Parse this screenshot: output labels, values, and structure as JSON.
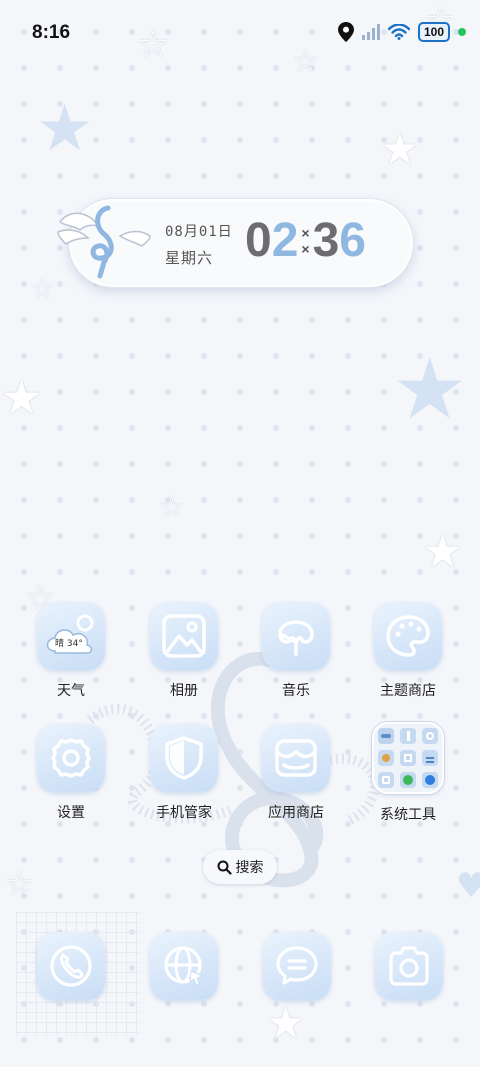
{
  "status_bar": {
    "time": "8:16",
    "battery": "100"
  },
  "clock_widget": {
    "date": "08月01日",
    "weekday": "星期六",
    "hour_1": "0",
    "hour_2": "2",
    "minute_1": "3",
    "minute_2": "6"
  },
  "apps": [
    {
      "label": "天气",
      "icon": "weather-icon",
      "weather_text": "晴 34°"
    },
    {
      "label": "相册",
      "icon": "gallery-icon"
    },
    {
      "label": "音乐",
      "icon": "music-icon"
    },
    {
      "label": "主题商店",
      "icon": "theme-store-icon"
    },
    {
      "label": "设置",
      "icon": "settings-icon"
    },
    {
      "label": "手机管家",
      "icon": "phone-manager-icon"
    },
    {
      "label": "应用商店",
      "icon": "app-store-icon"
    },
    {
      "label": "系统工具",
      "icon": "system-tools-folder-icon"
    }
  ],
  "search": {
    "label": "搜索"
  },
  "dock": [
    {
      "icon": "phone-icon"
    },
    {
      "icon": "browser-icon"
    },
    {
      "icon": "messages-icon"
    },
    {
      "icon": "camera-icon"
    }
  ],
  "colors": {
    "accent_blue": "#8fb7e2",
    "tile_gradient_top": "#eaf3fd",
    "tile_gradient_bottom": "#c8ddf5",
    "digit_grey": "#6d6d70",
    "charge_green": "#22c55e"
  }
}
